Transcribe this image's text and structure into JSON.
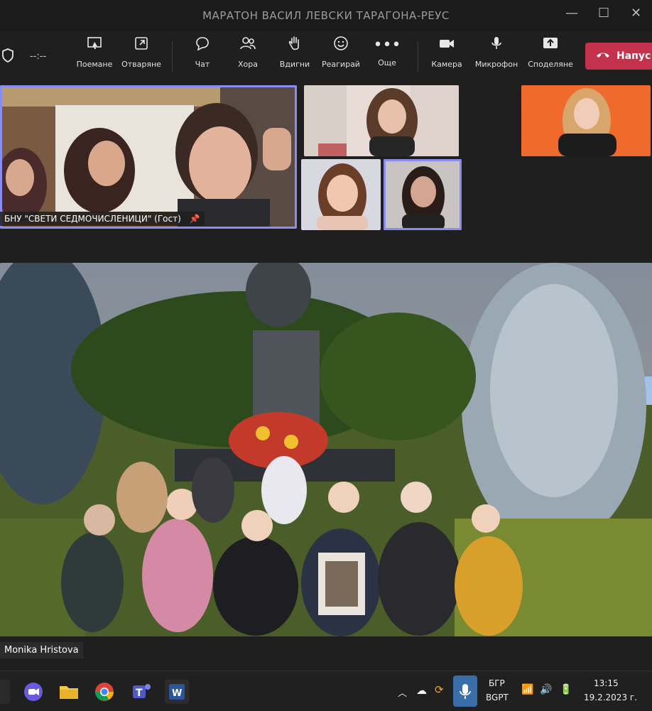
{
  "window": {
    "title": "МАРАТОН ВАСИЛ ЛЕВСКИ ТАРАГОНА-РЕУС",
    "minimize": "—",
    "maximize": "☐",
    "close": "✕"
  },
  "toolbar": {
    "timer": "--:--",
    "buttons": [
      {
        "label": "Поемане",
        "icon": "take-control-icon"
      },
      {
        "label": "Отваряне",
        "icon": "pop-out-icon"
      },
      {
        "label": "Чат",
        "icon": "chat-icon"
      },
      {
        "label": "Хора",
        "icon": "people-icon"
      },
      {
        "label": "Вдигни",
        "icon": "raise-hand-icon"
      },
      {
        "label": "Реагирай",
        "icon": "react-icon"
      },
      {
        "label": "Още",
        "icon": "more-icon"
      },
      {
        "label": "Камера",
        "icon": "camera-icon"
      },
      {
        "label": "Микрофон",
        "icon": "microphone-icon"
      },
      {
        "label": "Споделяне",
        "icon": "share-icon"
      }
    ],
    "leave_label": "Напус"
  },
  "participants": {
    "main_name": "БНУ \"СВЕТИ СЕДМОЧИСЛЕНИЦИ\" (Гост)"
  },
  "shared_content": {
    "presenter": "Monika Hristova"
  },
  "taskbar": {
    "lang_top": "БГР",
    "lang_bottom": "BGPT",
    "time": "13:15",
    "date": "19.2.2023 г."
  },
  "colors": {
    "accent": "#8b8cf0",
    "leave": "#c4314b",
    "orange_bg": "#f06a2e"
  }
}
